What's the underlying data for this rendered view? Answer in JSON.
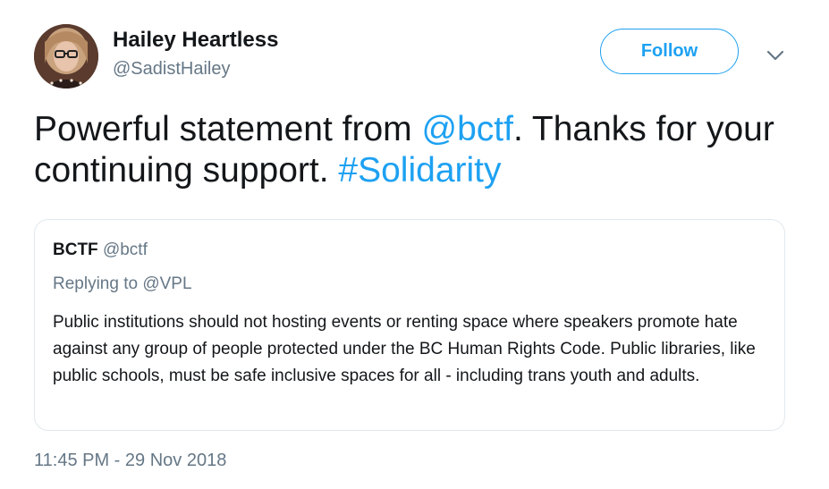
{
  "author": {
    "display_name": "Hailey Heartless",
    "handle": "@SadistHailey",
    "avatar_icon": "profile-photo"
  },
  "actions": {
    "follow_label": "Follow",
    "more_icon": "chevron-down-icon"
  },
  "tweet": {
    "text_part1": "Powerful statement from ",
    "mention": "@bctf",
    "text_part2": ". Thanks for your continuing support. ",
    "hashtag": "#Solidarity",
    "timestamp": "11:45 PM - 29 Nov 2018"
  },
  "quoted_tweet": {
    "name": "BCTF",
    "handle": "@bctf",
    "replying_to": "Replying to @VPL",
    "text": "Public institutions should not hosting events or renting space where speakers promote hate against any group of people protected under the BC Human Rights Code. Public libraries, like public schools, must be safe inclusive spaces for all - including trans youth and adults."
  },
  "colors": {
    "accent": "#1da1f2",
    "text": "#14171a",
    "secondary": "#657786",
    "border": "#e1e8ed"
  }
}
